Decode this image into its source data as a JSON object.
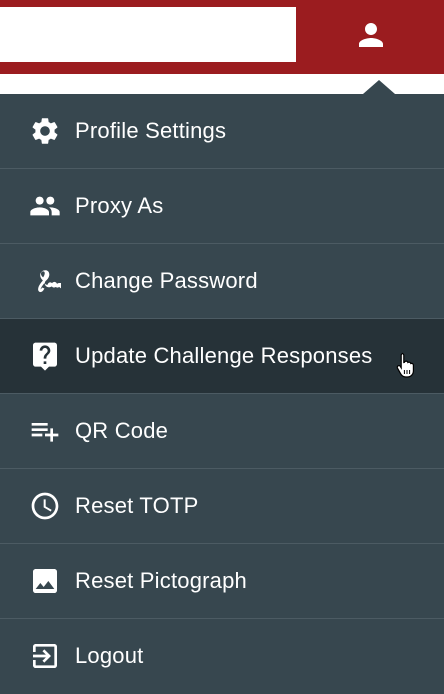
{
  "header": {
    "search_value": "",
    "user_icon": "account-icon",
    "brand_color": "#9b1c1f"
  },
  "menu": {
    "background": "#37474f",
    "items": [
      {
        "label": "Profile Settings",
        "icon": "gear-icon",
        "active": false
      },
      {
        "label": "Proxy As",
        "icon": "people-icon",
        "active": false
      },
      {
        "label": "Change Password",
        "icon": "signature-icon",
        "active": false
      },
      {
        "label": "Update Challenge Responses",
        "icon": "question-icon",
        "active": true
      },
      {
        "label": "QR Code",
        "icon": "playlist-add-icon",
        "active": false
      },
      {
        "label": "Reset TOTP",
        "icon": "clock-icon",
        "active": false
      },
      {
        "label": "Reset Pictograph",
        "icon": "image-icon",
        "active": false
      },
      {
        "label": "Logout",
        "icon": "logout-icon",
        "active": false
      }
    ]
  }
}
